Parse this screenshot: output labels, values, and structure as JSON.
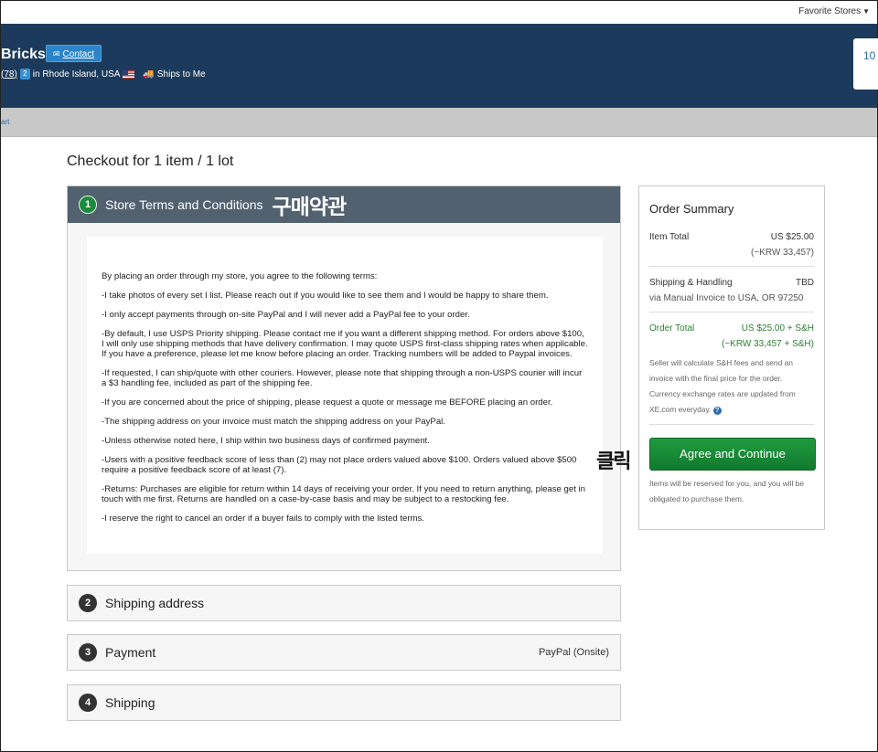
{
  "topbar": {
    "favorite_stores": "Favorite Stores"
  },
  "store": {
    "name": "Bricks",
    "contact_label": "Contact",
    "feedback": "(78)",
    "badge": "2",
    "location": "in Rhode Island, USA",
    "ships": "Ships to Me",
    "cart_count": "10"
  },
  "subnav": {
    "link": "art"
  },
  "checkout": {
    "title": "Checkout for 1 item / 1 lot"
  },
  "step1": {
    "number": "1",
    "title": "Store Terms and Conditions",
    "annotation": "구매약관",
    "terms": [
      "By placing an order through my store, you agree to the following terms:",
      "-I take photos of every set I list. Please reach out if you would like to see them and I would be happy to share them.",
      "-I only accept payments through on-site PayPal and I will never add a PayPal fee to your order.",
      "-By default, I use USPS Priority shipping. Please contact me if you want a different shipping method. For orders above $100, I will only use shipping methods that have delivery confirmation. I may quote USPS first-class shipping rates when applicable. If you have a preference, please let me know before placing an order. Tracking numbers will be added to Paypal invoices.",
      "-If requested, I can ship/quote with other couriers. However, please note that shipping through a non-USPS courier will incur a $3 handling fee, included as part of the shipping fee.",
      "-If you are concerned about the price of shipping, please request a quote or message me BEFORE placing an order.",
      "-The shipping address on your invoice must match the shipping address on your PayPal.",
      "-Unless otherwise noted here, I ship within two business days of confirmed payment.",
      "-Users with a positive feedback score of less than (2) may not place orders valued above $100. Orders valued above $500 require a positive feedback score of at least (7).",
      "-Returns: Purchases are eligible for return within 14 days of receiving your order. If you need to return anything, please get in touch with me first. Returns are handled on a case-by-case basis and may be subject to a restocking fee.",
      "-I reserve the right to cancel an order if a buyer fails to comply with the listed terms."
    ]
  },
  "steps": [
    {
      "number": "2",
      "label": "Shipping address",
      "right": ""
    },
    {
      "number": "3",
      "label": "Payment",
      "right": "PayPal (Onsite)"
    },
    {
      "number": "4",
      "label": "Shipping",
      "right": ""
    }
  ],
  "summary": {
    "title": "Order Summary",
    "item_total_label": "Item Total",
    "item_total_value": "US $25.00",
    "item_total_krw": "(~KRW 33,457)",
    "shipping_label": "Shipping & Handling",
    "shipping_value": "TBD",
    "shipping_via": "via Manual Invoice to USA, OR 97250",
    "order_total_label": "Order Total",
    "order_total_value": "US $25.00 + S&H",
    "order_total_krw": "(~KRW 33,457 + S&H)",
    "note": "Seller will calculate S&H fees and send an invoice with the final price for the order. Currency exchange rates are updated from XE.com everyday.",
    "agree_button": "Agree and Continue",
    "reserve_note": "Items will be reserved for you, and you will be obligated to purchase them."
  },
  "annotation_click": "클릭"
}
